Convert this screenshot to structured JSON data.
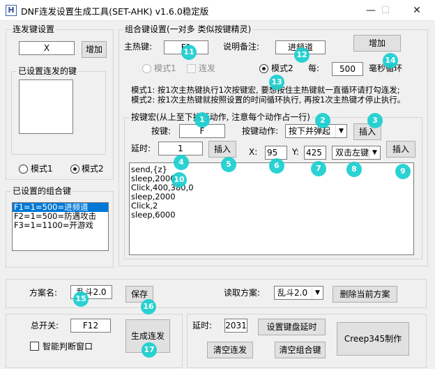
{
  "window": {
    "title": "DNF连发设置生成工具(SET-AHK) v1.6.0稳定版",
    "app_icon_letter": "H",
    "minimize_glyph": "—",
    "maximize_glyph": "☐",
    "close_glyph": "✕"
  },
  "burst": {
    "group_title": "连发键设置",
    "key_value": "X",
    "add_label": "增加",
    "set_keys_title": "已设置连发的键",
    "mode1_label": "模式1",
    "mode2_label": "模式2",
    "selected_mode": "mode2"
  },
  "combos": {
    "group_title": "已设置的组合键",
    "items": [
      "F1=1=500=进频道",
      "F2=1=500=防遇攻击",
      "F3=1=1100=开游戏"
    ],
    "selected_index": 0
  },
  "combo_settings": {
    "group_title": "组合键设置(一对多 类似按键精灵)",
    "main_key_label": "主热键:",
    "main_key_value": "F1",
    "note_label": "说明备注:",
    "note_value": "进频道",
    "add_label": "增加",
    "mode1_label": "模式1",
    "burst_label": "连发",
    "mode2_label": "模式2",
    "every_label": "每:",
    "interval_value": "500",
    "interval_unit": "毫秒循环",
    "desc_mode1": "模式1: 按1次主热键执行1次按键宏, 要想按住主热键就一直循环请打勾连发;",
    "desc_mode2": "模式2: 按1次主热键就按照设置的时间循环执行, 再按1次主热键才停止执行。"
  },
  "macro": {
    "group_title": "按键宏(从上至下执行动作, 注意每个动作占一行)",
    "key_label": "按键:",
    "key_value": "F",
    "action_label": "按键动作:",
    "action_value": "按下并弹起",
    "insert_label": "插入",
    "delay_label": "延时:",
    "delay_value": "1",
    "x_label": "X:",
    "x_value": "95",
    "y_label": "Y:",
    "y_value": "425",
    "click_value": "双击左键",
    "lines": [
      "send,{z}",
      "sleep,2000",
      "Click,400,380,0",
      "sleep,2000",
      "Click,2",
      "sleep,6000"
    ]
  },
  "scheme": {
    "name_label": "方案名:",
    "name_value": "乱斗2.0",
    "save_label": "保存",
    "load_label": "读取方案:",
    "load_value": "乱斗2.0",
    "delete_label": "删除当前方案"
  },
  "master": {
    "switch_label": "总开关:",
    "switch_value": "F12",
    "smart_label": "智能判断窗口",
    "generate_label": "生成连发"
  },
  "actions": {
    "delay_label": "延时:",
    "delay_value": "2031",
    "set_delay_label": "设置键盘延时",
    "clear_burst_label": "清空连发",
    "clear_combo_label": "清空组合键",
    "credit_label": "Creep345制作"
  },
  "markers": [
    "1",
    "2",
    "3",
    "4",
    "5",
    "6",
    "7",
    "8",
    "9",
    "10",
    "11",
    "12",
    "13",
    "14",
    "15",
    "16",
    "17"
  ],
  "colors": {
    "marker": "#19cfd0",
    "selection": "#0078d7"
  }
}
